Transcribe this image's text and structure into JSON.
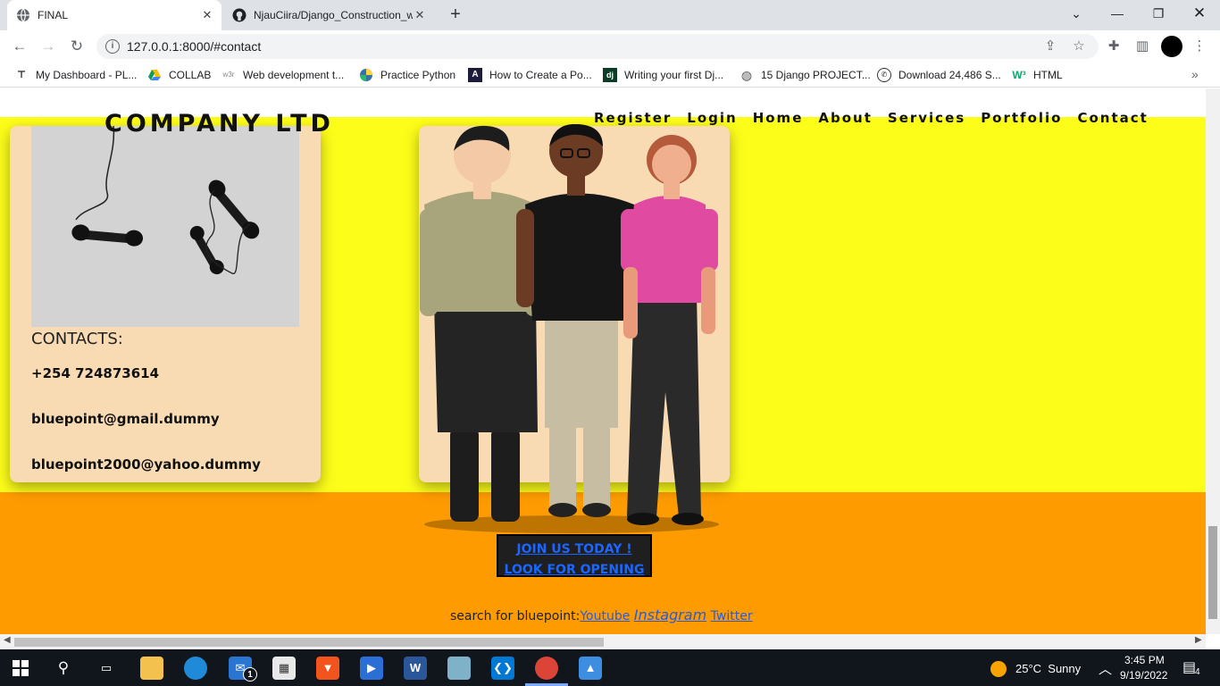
{
  "browser": {
    "tabs": [
      {
        "title": "FINAL",
        "active": true
      },
      {
        "title": "NjauCiira/Django_Construction_w",
        "active": false
      }
    ],
    "url": "127.0.0.1:8000/#contact",
    "bookmarks": [
      "My Dashboard - PL...",
      "COLLAB",
      "Web development t...",
      "Practice Python",
      "How to Create a Po...",
      "Writing your first Dj...",
      "15 Django PROJECT...",
      "Download 24,486 S...",
      "HTML"
    ],
    "bookmark_icons": {
      "w3": "w3r",
      "dj": "dj",
      "html": "W³"
    }
  },
  "site": {
    "brand": "COMPANY LTD",
    "nav": [
      "Register",
      "Login",
      "Home",
      "About",
      "Services",
      "Portfolio",
      "Contact"
    ],
    "contact": {
      "heading": "CONTACTS:",
      "phone": "+254 724873614",
      "email1": "bluepoint@gmail.dummy",
      "email2": "bluepoint2000@yahoo.dummy"
    },
    "join": {
      "line1": "JOIN US TODAY !",
      "line2": "LOOK FOR OPENING"
    },
    "search": {
      "prefix": "search for bluepoint:",
      "links": [
        "Youtube",
        "Instagram",
        "Twitter"
      ]
    },
    "colors": {
      "yellow": "#fdfd1a",
      "orange": "#fe9b00",
      "card": "#f8dbb3",
      "link": "#1a66ff"
    }
  },
  "taskbar": {
    "weather": "25°C  Sunny",
    "time": "3:45 PM",
    "date": "9/19/2022",
    "notification_count": "4",
    "mail_badge": "1"
  }
}
